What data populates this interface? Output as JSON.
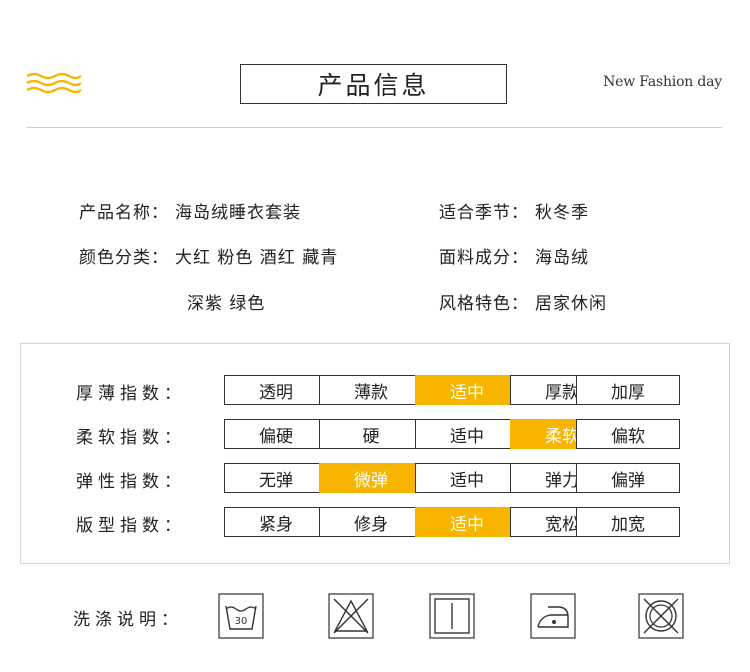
{
  "header": {
    "title": "产品信息",
    "tagline": "New Fashion day",
    "accent_color": "#f7b500"
  },
  "info": {
    "name": {
      "label": "产品名称：",
      "value": "海岛绒睡衣套装"
    },
    "season": {
      "label": "适合季节：",
      "value": "秋冬季"
    },
    "color": {
      "label": "颜色分类：",
      "value": "大红 粉色 酒红 藏青",
      "value2": "深紫 绿色"
    },
    "fabric": {
      "label": "面料成分：",
      "value": "海岛绒"
    },
    "style": {
      "label": "风格特色：",
      "value": "居家休闲"
    }
  },
  "indices": [
    {
      "label": "厚薄指数：",
      "options": [
        "透明",
        "薄款",
        "适中",
        "厚款",
        "加厚"
      ],
      "selected": 2
    },
    {
      "label": "柔软指数：",
      "options": [
        "偏硬",
        "硬",
        "适中",
        "柔软",
        "偏软"
      ],
      "selected": 3
    },
    {
      "label": "弹性指数：",
      "options": [
        "无弹",
        "微弹",
        "适中",
        "弹力",
        "偏弹"
      ],
      "selected": 1
    },
    {
      "label": "版型指数：",
      "options": [
        "紧身",
        "修身",
        "适中",
        "宽松",
        "加宽"
      ],
      "selected": 2
    }
  ],
  "washing": {
    "label": "洗涤说明：",
    "temperature": "30",
    "icons": [
      "wash-30-icon",
      "no-bleach-icon",
      "tumble-dry-icon",
      "iron-low-icon",
      "no-dry-clean-icon"
    ]
  }
}
